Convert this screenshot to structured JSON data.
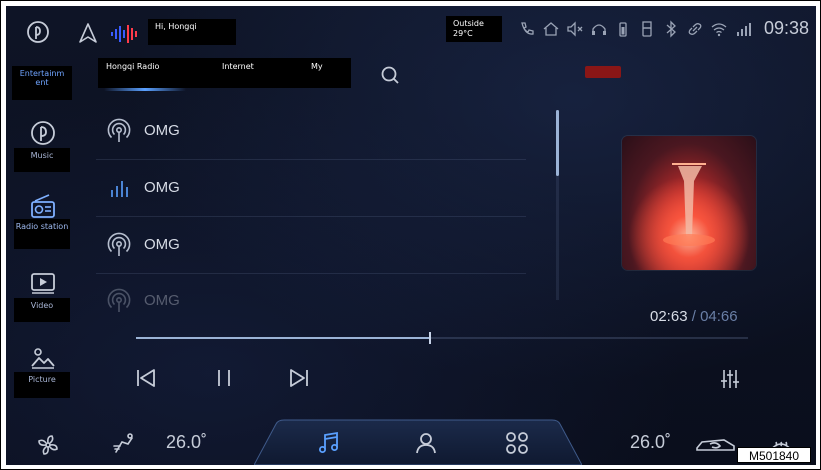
{
  "status": {
    "greeting": "Hi, Hongqi",
    "outside_label": "Outside",
    "outside_temp": "29°C",
    "time": "09:38"
  },
  "sidebar": {
    "items": [
      {
        "label": "Entertainm ent",
        "icon": "entertainment-icon"
      },
      {
        "label": "Music",
        "icon": "music-icon"
      },
      {
        "label": "Radio station",
        "icon": "radio-icon"
      },
      {
        "label": "Video",
        "icon": "video-icon"
      },
      {
        "label": "Picture",
        "icon": "picture-icon"
      }
    ]
  },
  "tabs": [
    "Hongqi Radio",
    "Internet",
    "My"
  ],
  "list": [
    {
      "title": "OMG",
      "icon": "broadcast-icon",
      "state": "normal"
    },
    {
      "title": "OMG",
      "icon": "playing-bars-icon",
      "state": "playing"
    },
    {
      "title": "OMG",
      "icon": "broadcast-icon",
      "state": "normal"
    },
    {
      "title": "OMG",
      "icon": "broadcast-icon",
      "state": "dimmed"
    }
  ],
  "player": {
    "current_time": "02:63",
    "separator": " / ",
    "total_time": "04:66",
    "progress": 0.48
  },
  "climate": {
    "left_temp": "26.0˚",
    "right_temp": "26.0˚"
  },
  "figure_code": "M501840",
  "colors": {
    "accent": "#5aa0ff",
    "background": "#0b1020",
    "text": "#d7dce6",
    "muted": "#6a7fa6"
  }
}
